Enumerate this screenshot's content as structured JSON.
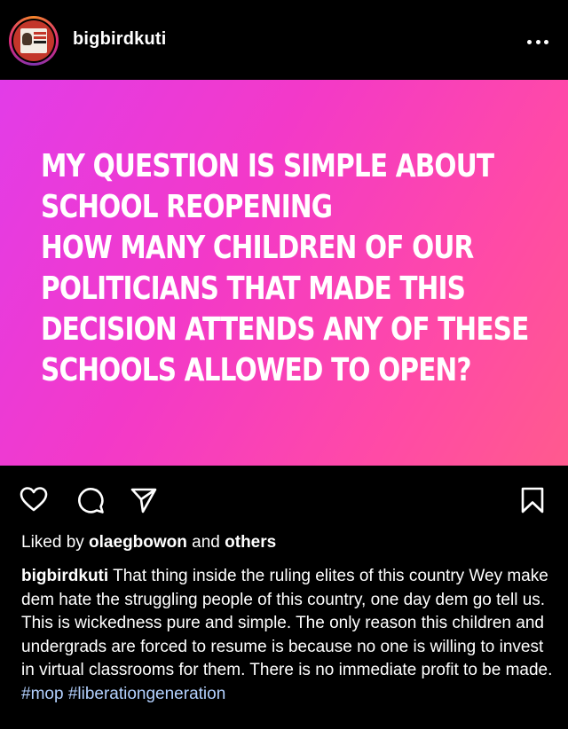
{
  "header": {
    "username": "bigbirdkuti",
    "avatar_icon": "profile-avatar",
    "more_icon": "more-horizontal-icon"
  },
  "post": {
    "text_lines": [
      "MY QUESTION IS SIMPLE ABOUT",
      "SCHOOL REOPENING",
      "HOW MANY CHILDREN OF OUR",
      "POLITICIANS THAT MADE THIS",
      "DECISION ATTENDS ANY OF THESE",
      "SCHOOLS ALLOWED TO OPEN?"
    ],
    "gradient_colors": [
      "#e23ce8",
      "#ff5a8e"
    ]
  },
  "actions": {
    "like_icon": "heart-icon",
    "comment_icon": "comment-icon",
    "share_icon": "send-icon",
    "save_icon": "bookmark-icon"
  },
  "likes": {
    "prefix": "Liked by ",
    "user": "olaegbowon",
    "middle": " and ",
    "others": "others"
  },
  "caption": {
    "username": "bigbirdkuti",
    "text": " That thing inside the ruling elites of this country Wey make dem hate the struggling people of this country, one day dem go tell us. This is wickedness pure and simple. The only reason this children and undergrads are forced to resume is because no one is willing to invest in virtual classrooms for them. There is no immediate profit to be made. ",
    "hashtags": [
      "#mop",
      "#liberationgeneration"
    ]
  },
  "colors": {
    "background": "#000000",
    "text": "#ffffff",
    "hashtag": "#b3d1ff"
  }
}
